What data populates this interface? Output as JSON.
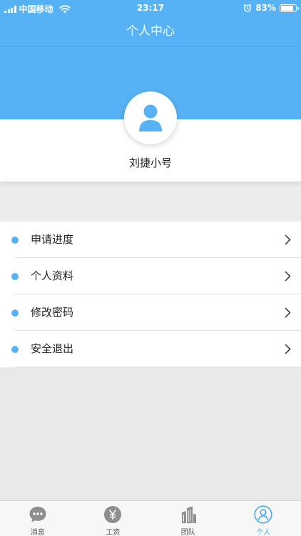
{
  "status_bar": {
    "carrier": "中国移动",
    "time": "23:17",
    "battery": "83%",
    "battery_level": 0.83
  },
  "navbar": {
    "title": "个人中心"
  },
  "profile": {
    "name": "刘捷小号",
    "avatar_icon": "user-icon"
  },
  "menu": {
    "items": [
      {
        "label": "申请进度"
      },
      {
        "label": "个人资料"
      },
      {
        "label": "修改密码"
      },
      {
        "label": "安全退出"
      }
    ]
  },
  "tabbar": {
    "tabs": [
      {
        "label": "消息",
        "icon": "message-icon",
        "active": false
      },
      {
        "label": "工资",
        "icon": "yen-icon",
        "active": false
      },
      {
        "label": "团队",
        "icon": "building-icon",
        "active": false
      },
      {
        "label": "个人",
        "icon": "person-icon",
        "active": true
      }
    ]
  },
  "colors": {
    "accent": "#56b2f5",
    "active_tab": "#4aa6ee",
    "inactive_icon": "#8e8e8e"
  }
}
